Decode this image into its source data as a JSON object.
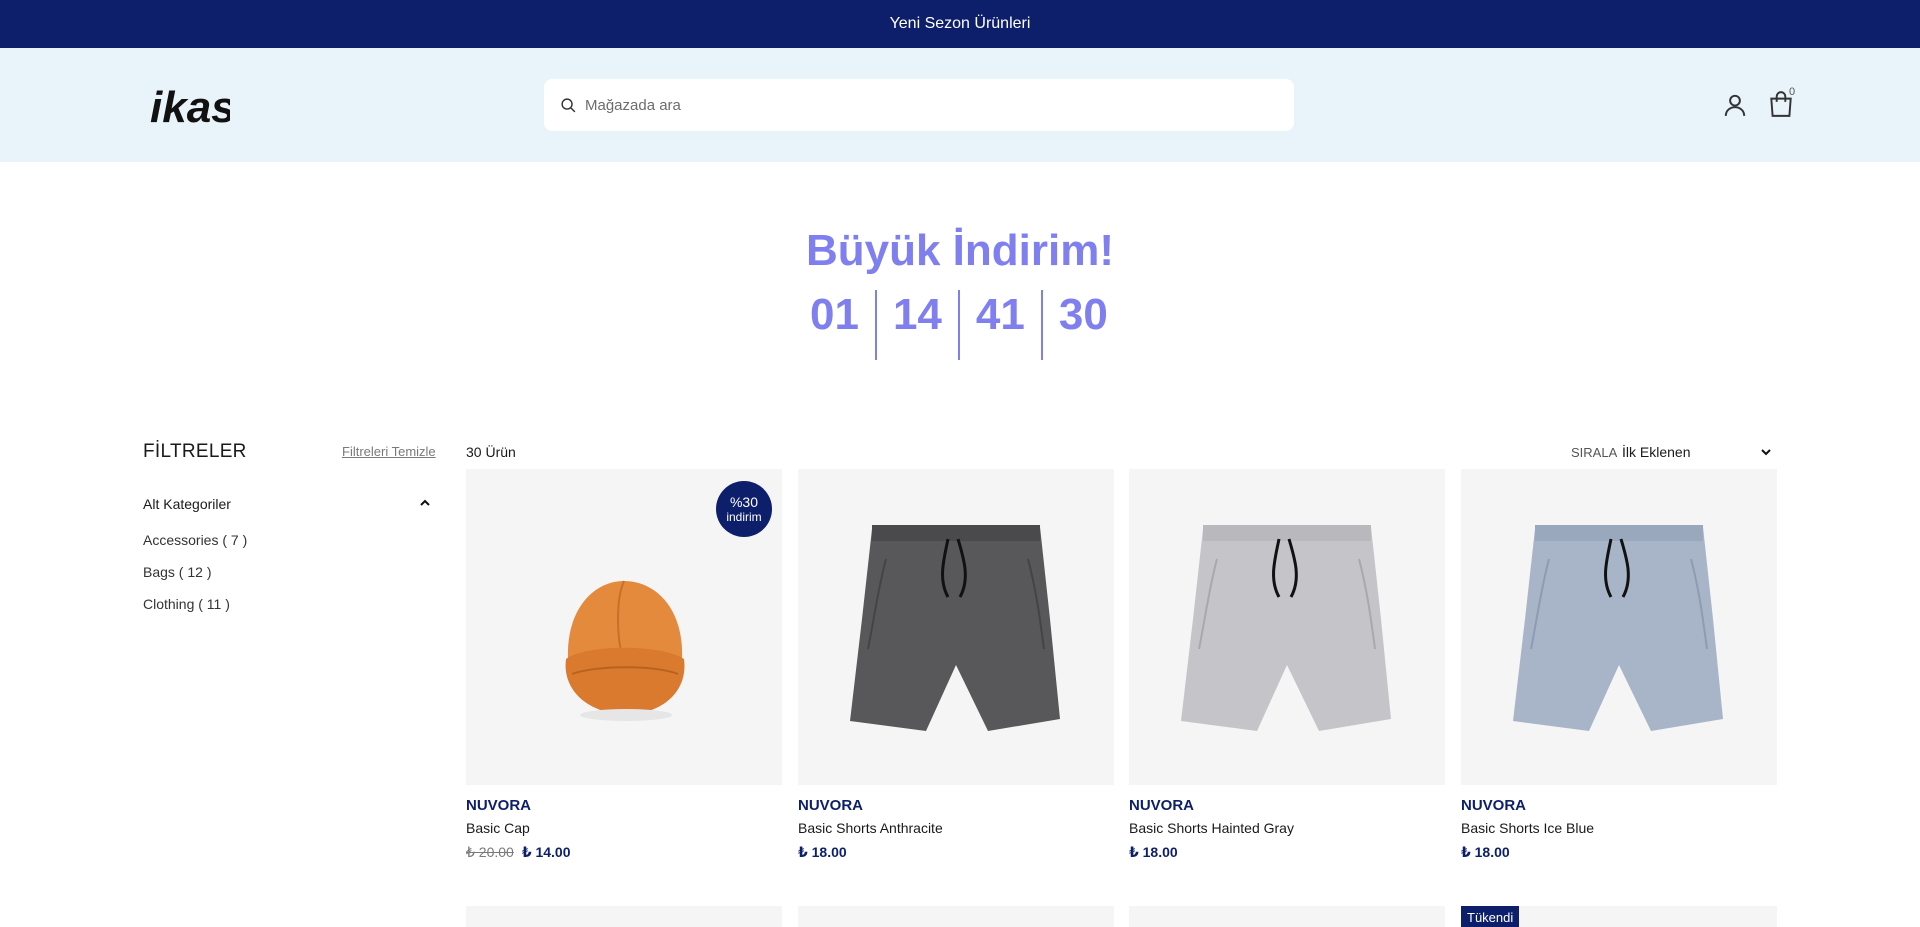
{
  "announcement": "Yeni Sezon Ürünleri",
  "header": {
    "logo_text": "ikas",
    "search_placeholder": "Mağazada ara",
    "cart_count": "0"
  },
  "promo": {
    "title": "Büyük İndirim!",
    "countdown": [
      "01",
      "14",
      "41",
      "30"
    ]
  },
  "filters": {
    "title": "FİLTRELER",
    "clear_label": "Filtreleri Temizle",
    "section_title": "Alt Kategoriler",
    "categories": [
      "Accessories ( 7 )",
      "Bags ( 12 )",
      "Clothing ( 11 )"
    ]
  },
  "listing": {
    "count_label": "30 Ürün",
    "sort_label": "SIRALA",
    "sort_value": "İlk Eklenen"
  },
  "products": [
    {
      "brand": "NUVORA",
      "name": "Basic Cap",
      "old_price": "₺ 20.00",
      "price": "₺ 14.00",
      "badge_line1": "%30",
      "badge_line2": "indirim"
    },
    {
      "brand": "NUVORA",
      "name": "Basic Shorts Anthracite",
      "price": "₺ 18.00"
    },
    {
      "brand": "NUVORA",
      "name": "Basic Shorts Hainted Gray",
      "price": "₺ 18.00"
    },
    {
      "brand": "NUVORA",
      "name": "Basic Shorts Ice Blue",
      "price": "₺ 18.00"
    }
  ],
  "second_row": {
    "soldout_label": "Tükendi"
  },
  "colors": {
    "primary": "#0d1f6b",
    "promo": "#7f7ff0",
    "header_bg": "#e9f3fa",
    "card_bg": "#f5f5f5"
  },
  "icons": [
    "search-icon",
    "user-icon",
    "shopping-bag-icon",
    "chevron-up-icon",
    "chevron-down-icon"
  ]
}
